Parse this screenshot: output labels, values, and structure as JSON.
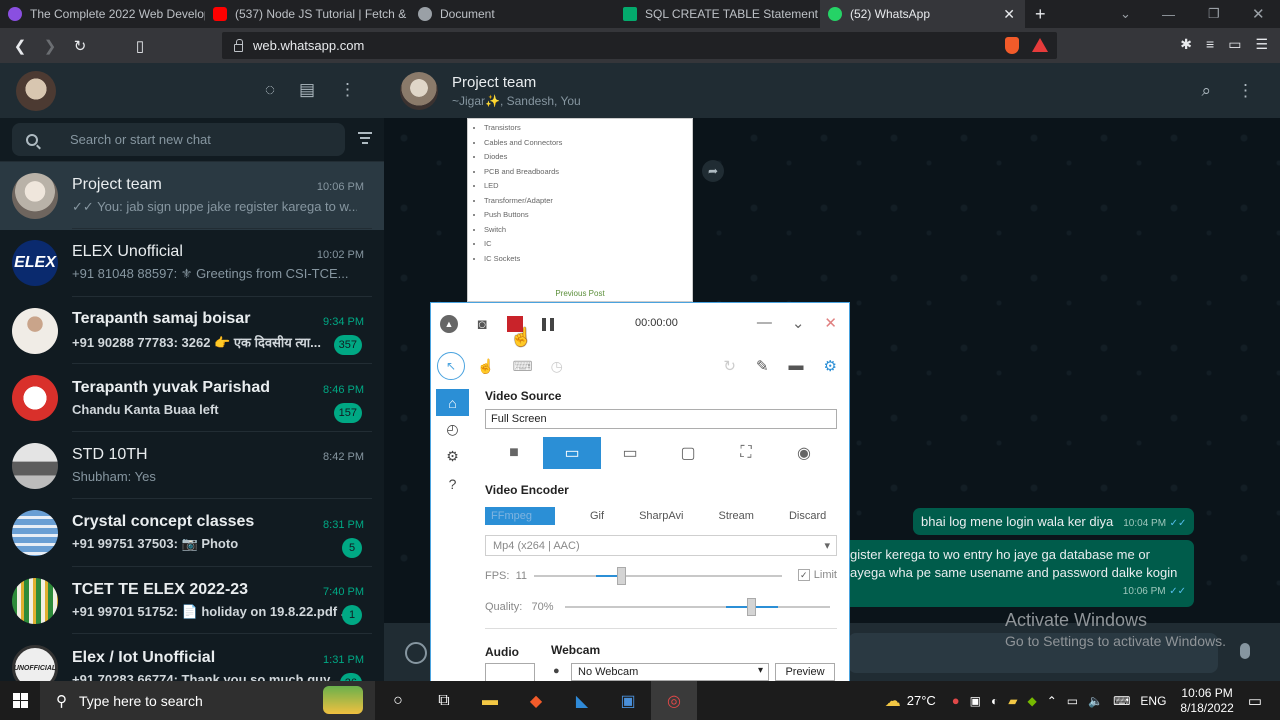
{
  "browser": {
    "tabs": [
      {
        "title": "The Complete 2022 Web Develop",
        "color": "#8a4fe0"
      },
      {
        "title": "(537) Node JS Tutorial | Fetch & D",
        "color": "#ff0000"
      },
      {
        "title": "Document",
        "color": "#9aa0a6"
      },
      {
        "title": "SQL CREATE TABLE Statement",
        "color": "#04aa6d"
      },
      {
        "title": "(52) WhatsApp",
        "color": "#25d366"
      }
    ],
    "url": "web.whatsapp.com"
  },
  "sidebar": {
    "search_placeholder": "Search or start new chat",
    "chats": [
      {
        "name": "Project team",
        "message": "✓✓ You: jab sign uppe jake register karega to w...",
        "time": "10:06 PM",
        "badge": "",
        "avatar_color": "#b9b2a8",
        "avatar_text": ""
      },
      {
        "name": "ELEX Unofficial",
        "message": "+91 81048 88597: ⚜ Greetings from CSI-TCE...",
        "time": "10:02 PM",
        "badge": "",
        "avatar_color": "#0a2a6e",
        "avatar_text": "ELEX"
      },
      {
        "name": "Terapanth samaj boisar",
        "message": "+91 90288 77783: 3262 👉 एक दिवसीय त्या...",
        "time": "9:34 PM",
        "badge": "357",
        "avatar_color": "#e8e2da",
        "avatar_text": ""
      },
      {
        "name": "Terapanth yuvak Parishad",
        "message": "Chandu Kanta Buaa left",
        "time": "8:46 PM",
        "badge": "157",
        "avatar_color": "#d9302b",
        "avatar_text": ""
      },
      {
        "name": "STD 10TH",
        "message": "Shubham: Yes",
        "time": "8:42 PM",
        "badge": "",
        "avatar_color": "#9a9a9a",
        "avatar_text": ""
      },
      {
        "name": "Crystal concept classes",
        "message": "+91 99751 37503: 📷 Photo",
        "time": "8:31 PM",
        "badge": "5",
        "avatar_color": "#6a9fd4",
        "avatar_text": ""
      },
      {
        "name": "TCET TE ELEX 2022-23",
        "message": "+91 99701 51752: 📄 holiday on 19.8.22.pdf ...",
        "time": "7:40 PM",
        "badge": "1",
        "avatar_color": "#d8c8a0",
        "avatar_text": ""
      },
      {
        "name": "Elex / Iot Unofficial",
        "message": "+91 70283 66774: Thank you so much guy...",
        "time": "1:31 PM",
        "badge": "26",
        "avatar_color": "#eeeeee",
        "avatar_text": "UNOFFICIAL"
      }
    ]
  },
  "conversation": {
    "title": "Project team",
    "subtitle": "~Jigar✨, Sandesh, You",
    "doc_items": [
      "Transistors",
      "Cables and Connectors",
      "Diodes",
      "PCB and Breadboards",
      "LED",
      "Transformer/Adapter",
      "Push Buttons",
      "Switch",
      "IC",
      "IC Sockets"
    ],
    "doc_prev": "Previous Post",
    "messages": [
      {
        "text": "bhai log mene login wala ker diya",
        "time": "10:04 PM"
      },
      {
        "text": "gister kerega to wo entry ho jaye ga database  me or",
        "text2": "ayega  wha pe same  usename and password dalke kogin",
        "time": "10:06 PM"
      }
    ]
  },
  "recorder": {
    "timer": "00:00:00",
    "video_source_label": "Video Source",
    "video_source_value": "Full Screen",
    "video_encoder_label": "Video Encoder",
    "encoders": [
      "FFmpeg",
      "Gif",
      "SharpAvi",
      "Stream",
      "Discard"
    ],
    "format": "Mp4 (x264 | AAC)",
    "fps_label": "FPS:",
    "fps_value": "11",
    "limit_label": "Limit",
    "quality_label": "Quality:",
    "quality_value": "70%",
    "audio_label": "Audio",
    "webcam_label": "Webcam",
    "webcam_value": "No Webcam",
    "preview_label": "Preview",
    "fps_level": 0.35,
    "quality_level": 0.7
  },
  "activation": {
    "line1": "Activate Windows",
    "line2": "Go to Settings to activate Windows."
  },
  "taskbar": {
    "search_placeholder": "Type here to search",
    "temperature": "27°C",
    "language": "ENG",
    "time": "10:06 PM",
    "date": "8/18/2022"
  }
}
